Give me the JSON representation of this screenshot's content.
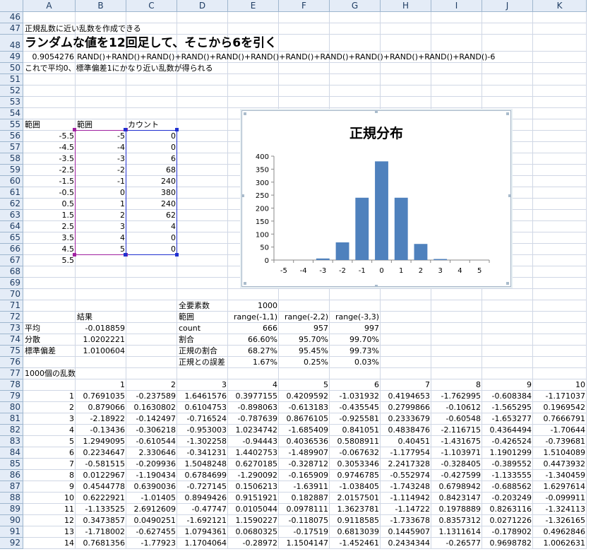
{
  "columns": [
    "A",
    "B",
    "C",
    "D",
    "E",
    "F",
    "G",
    "H",
    "I",
    "J",
    "K"
  ],
  "rows": [
    46,
    47,
    48,
    49,
    50,
    51,
    52,
    53,
    54,
    55,
    56,
    57,
    58,
    59,
    60,
    61,
    62,
    63,
    64,
    65,
    66,
    67,
    68,
    69,
    70,
    71,
    72,
    73,
    74,
    75,
    76,
    77,
    78,
    79,
    80,
    81,
    82,
    83,
    84,
    85,
    86,
    87,
    88,
    89,
    90,
    91,
    92
  ],
  "notes": {
    "r47": "正規乱数に近い乱数を作成できる",
    "r48": "ランダムな値を12回足して、そこから6を引く",
    "r49_value": "0.9054276",
    "r49_formula": "RAND()+RAND()+RAND()+RAND()+RAND()+RAND()+RAND()+RAND()+RAND()+RAND()+RAND()+RAND()-6",
    "r50": "これで平均0、標準偏差1にかなり近い乱数が得られる"
  },
  "bins": {
    "header_a": "範囲",
    "header_b": "範囲",
    "header_c": "カウント",
    "a": [
      "-5.5",
      "-4.5",
      "-3.5",
      "-2.5",
      "-1.5",
      "-0.5",
      "0.5",
      "1.5",
      "2.5",
      "3.5",
      "4.5",
      "5.5"
    ],
    "b": [
      "-5",
      "-4",
      "-3",
      "-2",
      "-1",
      "0",
      "1",
      "2",
      "3",
      "4",
      "5"
    ],
    "c": [
      "0",
      "0",
      "6",
      "68",
      "240",
      "380",
      "240",
      "62",
      "4",
      "0",
      "0"
    ]
  },
  "chart_data": {
    "type": "bar",
    "title": "正規分布",
    "categories": [
      "-5",
      "-4",
      "-3",
      "-2",
      "-1",
      "0",
      "1",
      "2",
      "3",
      "4",
      "5"
    ],
    "values": [
      0,
      0,
      6,
      68,
      240,
      380,
      240,
      62,
      4,
      0,
      0
    ],
    "yticks": [
      "0",
      "50",
      "100",
      "150",
      "200",
      "250",
      "300",
      "350",
      "400"
    ],
    "ylim": [
      0,
      400
    ],
    "bar_color": "#4f81bd",
    "grid": false
  },
  "stats": {
    "result_label": "結果",
    "labels": [
      "平均",
      "分散",
      "標準偏差"
    ],
    "values": [
      "-0.018859",
      "1.0202221",
      "1.0100604"
    ],
    "total_label": "全要素数",
    "total_value": "1000",
    "table": [
      [
        "範囲",
        "range(-1,1)",
        "range(-2,2)",
        "range(-3,3)"
      ],
      [
        "count",
        "666",
        "957",
        "997"
      ],
      [
        "割合",
        "66.60%",
        "95.70%",
        "99.70%"
      ],
      [
        "正規の割合",
        "68.27%",
        "95.45%",
        "99.73%"
      ],
      [
        "正規との誤差",
        "1.67%",
        "0.25%",
        "0.03%"
      ]
    ]
  },
  "random_label": "1000個の乱数",
  "random_header": [
    "1",
    "2",
    "3",
    "4",
    "5",
    "6",
    "7",
    "8",
    "9",
    "10"
  ],
  "random_rows": [
    [
      "1",
      "0.7691035",
      "-0.237589",
      "1.6461576",
      "0.3977155",
      "0.4209592",
      "-1.031932",
      "0.4194653",
      "-1.762995",
      "-0.608384",
      "-1.171037"
    ],
    [
      "2",
      "0.879066",
      "0.1630802",
      "0.6104753",
      "-0.898063",
      "-0.613183",
      "-0.435545",
      "0.2799866",
      "-0.10612",
      "-1.565295",
      "0.1969542"
    ],
    [
      "3",
      "-2.18922",
      "-0.142497",
      "-0.716524",
      "-0.787639",
      "0.8676105",
      "-0.925581",
      "0.2333679",
      "-0.60548",
      "-1.653277",
      "0.7666791"
    ],
    [
      "4",
      "-0.13436",
      "-0.306218",
      "-0.953003",
      "1.0234742",
      "-1.685409",
      "0.841051",
      "0.4838476",
      "-2.116715",
      "0.4364494",
      "-1.70644"
    ],
    [
      "5",
      "1.2949095",
      "-0.610544",
      "-1.302258",
      "-0.94443",
      "0.4036536",
      "0.5808911",
      "0.40451",
      "-1.431675",
      "-0.426524",
      "-0.739681"
    ],
    [
      "6",
      "0.2234647",
      "2.330646",
      "-0.341231",
      "1.4402753",
      "-1.489907",
      "-0.067632",
      "-1.177954",
      "-1.103971",
      "1.1901299",
      "1.5104089"
    ],
    [
      "7",
      "-0.581515",
      "-0.209936",
      "1.5048248",
      "0.6270185",
      "-0.328712",
      "0.3053346",
      "2.2417328",
      "-0.328405",
      "-0.389552",
      "0.4473932"
    ],
    [
      "8",
      "0.0122967",
      "-1.190434",
      "0.6784699",
      "-1.290092",
      "-0.165909",
      "0.9746785",
      "-0.552974",
      "-0.427599",
      "-1.133555",
      "-1.340459"
    ],
    [
      "9",
      "0.4544778",
      "0.6390036",
      "-0.727145",
      "0.1506213",
      "-1.63911",
      "-1.038405",
      "-1.743248",
      "0.6798942",
      "-0.688562",
      "1.6297614"
    ],
    [
      "10",
      "0.6222921",
      "-1.01405",
      "0.8949426",
      "0.9151921",
      "0.182887",
      "2.0157501",
      "-1.114942",
      "0.8423147",
      "-0.203249",
      "-0.099911"
    ],
    [
      "11",
      "-1.133525",
      "2.6912609",
      "-0.47747",
      "0.0105044",
      "0.0978111",
      "1.3623781",
      "-1.14722",
      "0.1978889",
      "0.8263116",
      "-1.324113"
    ],
    [
      "12",
      "0.3473857",
      "0.0490251",
      "-1.692121",
      "1.1590227",
      "-0.118075",
      "0.9118585",
      "-1.733678",
      "0.8357312",
      "0.0271226",
      "-1.326165"
    ],
    [
      "13",
      "-1.718002",
      "-0.627455",
      "1.0794361",
      "0.0680325",
      "-0.17519",
      "0.6813039",
      "0.1445907",
      "1.1311614",
      "-0.178902",
      "0.4962846"
    ],
    [
      "14",
      "0.7681356",
      "-1.77923",
      "1.1704064",
      "-0.28972",
      "1.1504147",
      "-1.452461",
      "0.2434344",
      "-0.26577",
      "0.9698782",
      "1.0062631"
    ]
  ]
}
